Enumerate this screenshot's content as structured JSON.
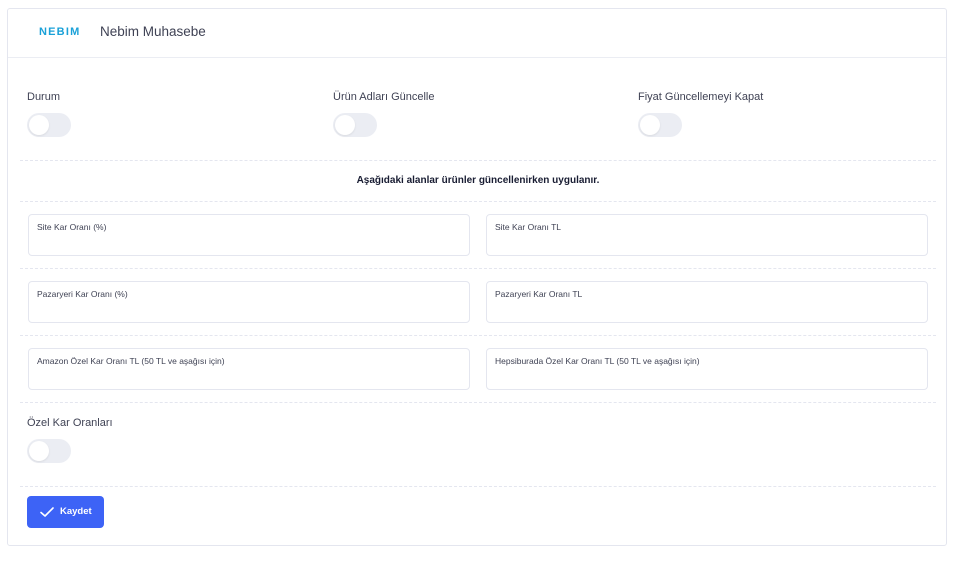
{
  "header": {
    "logo_text": "NEBIM",
    "brand_color": "#1aa1d8",
    "title": "Nebim Muhasebe"
  },
  "toggles": {
    "status": {
      "label": "Durum",
      "on": false
    },
    "update_product_names": {
      "label": "Ürün Adları Güncelle",
      "on": false
    },
    "disable_price_update": {
      "label": "Fiyat Güncellemeyi Kapat",
      "on": false
    },
    "custom_margins": {
      "label": "Özel Kar Oranları",
      "on": false
    }
  },
  "notice": "Aşağıdaki alanlar ürünler güncellenirken uygulanır.",
  "fields": {
    "site_margin_pct": {
      "label": "Site Kar Oranı (%)",
      "value": ""
    },
    "site_margin_tl": {
      "label": "Site Kar Oranı TL",
      "value": ""
    },
    "marketplace_margin_pct": {
      "label": "Pazaryeri Kar Oranı (%)",
      "value": ""
    },
    "marketplace_margin_tl": {
      "label": "Pazaryeri Kar Oranı TL",
      "value": ""
    },
    "amazon_special_margin_tl": {
      "label": "Amazon Özel Kar Oranı TL (50 TL ve aşağısı için)",
      "value": ""
    },
    "hepsiburada_special_margin_tl": {
      "label": "Hepsiburada Özel Kar Oranı TL (50 TL ve aşağısı için)",
      "value": ""
    }
  },
  "actions": {
    "save_label": "Kaydet",
    "save_icon": "check-icon",
    "accent_color": "#3d63f6"
  }
}
